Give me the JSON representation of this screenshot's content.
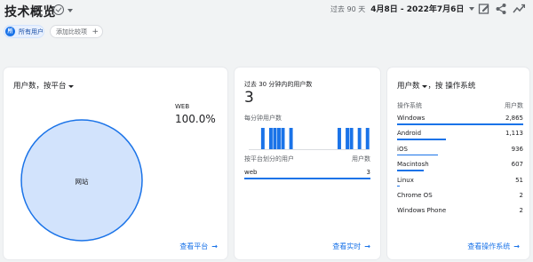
{
  "header": {
    "title": "技术概览",
    "date_prefix": "过去 90 天",
    "date_range": "4月8日 - 2022年7月6日"
  },
  "filters": {
    "segment_avatar": "所",
    "segment_label": "所有用户",
    "compare_label": "添加比较项",
    "compare_icon": "+"
  },
  "cards": {
    "platform": {
      "title": "用户数，按平台",
      "pie_label": "网站",
      "legend_name": "WEB",
      "legend_pct": "100.0%",
      "link": "查看平台",
      "arrow": "→"
    },
    "realtime": {
      "subtitle": "过去 30 分钟内的用户数",
      "count": "3",
      "per_minute": "每分钟用户数",
      "table_header_left": "按平台划分的用户",
      "table_header_right": "用户数",
      "row_label": "web",
      "row_value": "3",
      "link": "查看实时",
      "arrow": "→"
    },
    "os": {
      "title_dim": "用户数",
      "title_rest": "，按 操作系统",
      "col_left": "操作系统",
      "col_right": "用户数",
      "rows": [
        {
          "name": "Windows",
          "value": "2,865"
        },
        {
          "name": "Android",
          "value": "1,113"
        },
        {
          "name": "iOS",
          "value": "936"
        },
        {
          "name": "Macintosh",
          "value": "607"
        },
        {
          "name": "Linux",
          "value": "51"
        },
        {
          "name": "Chrome OS",
          "value": "2"
        },
        {
          "name": "Windows Phone",
          "value": "2"
        }
      ],
      "link": "查看操作系统",
      "arrow": "→"
    }
  },
  "chart_data": [
    {
      "type": "pie",
      "categories": [
        "网站"
      ],
      "values": [
        100.0
      ],
      "colors": [
        "#d2e3fc"
      ]
    },
    {
      "type": "bar",
      "values": [
        0,
        0,
        0,
        1,
        0,
        1,
        1,
        1,
        1,
        0,
        1,
        0,
        0,
        0,
        0,
        0,
        0,
        0,
        0,
        0,
        0,
        0,
        1,
        0,
        1,
        1,
        0,
        1,
        0,
        1
      ]
    }
  ],
  "colors": {
    "accent": "#1a73e8",
    "pie_fill": "#d2e3fc",
    "pie_stroke": "#1a73e8"
  }
}
